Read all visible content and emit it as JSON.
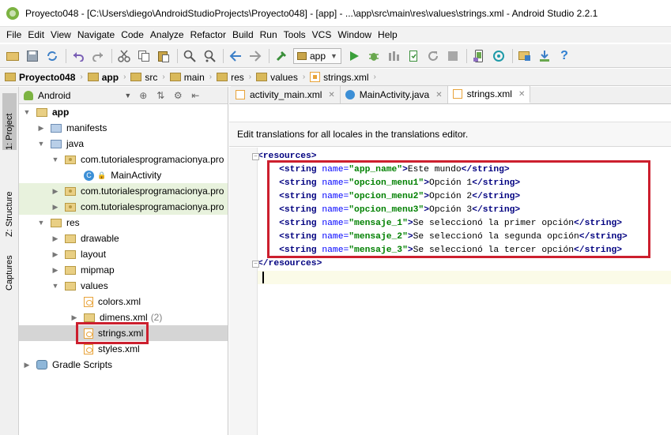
{
  "window": {
    "title": "Proyecto048 - [C:\\Users\\diego\\AndroidStudioProjects\\Proyecto048] - [app] - ...\\app\\src\\main\\res\\values\\strings.xml - Android Studio 2.2.1"
  },
  "menu": [
    "File",
    "Edit",
    "View",
    "Navigate",
    "Code",
    "Analyze",
    "Refactor",
    "Build",
    "Run",
    "Tools",
    "VCS",
    "Window",
    "Help"
  ],
  "toolbar": {
    "run_config": "app"
  },
  "breadcrumbs": [
    "Proyecto048",
    "app",
    "src",
    "main",
    "res",
    "values",
    "strings.xml"
  ],
  "side_tabs": {
    "project": "1: Project",
    "structure": "Z: Structure",
    "captures": "Captures"
  },
  "project_panel": {
    "view_mode": "Android"
  },
  "tree": [
    {
      "label": "app",
      "bold": true
    },
    {
      "label": "manifests"
    },
    {
      "label": "java"
    },
    {
      "label": "com.tutorialesprogramacionya.pro"
    },
    {
      "label": "MainActivity"
    },
    {
      "label": "com.tutorialesprogramacionya.pro"
    },
    {
      "label": "com.tutorialesprogramacionya.pro"
    },
    {
      "label": "res"
    },
    {
      "label": "drawable"
    },
    {
      "label": "layout"
    },
    {
      "label": "mipmap"
    },
    {
      "label": "values"
    },
    {
      "label": "colors.xml"
    },
    {
      "label": "dimens.xml",
      "count": "(2)"
    },
    {
      "label": "strings.xml"
    },
    {
      "label": "styles.xml"
    },
    {
      "label": "Gradle Scripts"
    }
  ],
  "editor_tabs": [
    {
      "label": "activity_main.xml"
    },
    {
      "label": "MainActivity.java"
    },
    {
      "label": "strings.xml",
      "active": true
    }
  ],
  "notice": "Edit translations for all locales in the translations editor.",
  "code": {
    "open_tag": "<resources>",
    "close_tag": "</resources>",
    "strings": [
      {
        "name": "app_name",
        "value": "Este mundo"
      },
      {
        "name": "opcion_menu1",
        "value": "Opción 1"
      },
      {
        "name": "opcion_menu2",
        "value": "Opción 2"
      },
      {
        "name": "opcion_menu3",
        "value": "Opción 3"
      },
      {
        "name": "mensaje_1",
        "value": "Se seleccionó la primer opción"
      },
      {
        "name": "mensaje_2",
        "value": "Se seleccionó la segunda opción"
      },
      {
        "name": "mensaje_3",
        "value": "Se seleccionó la tercer opción"
      }
    ]
  },
  "colors": {
    "highlight_box": "#cc1f2e",
    "xml_tag": "#000080",
    "xml_attr": "#0000ff",
    "xml_value": "#008000"
  }
}
